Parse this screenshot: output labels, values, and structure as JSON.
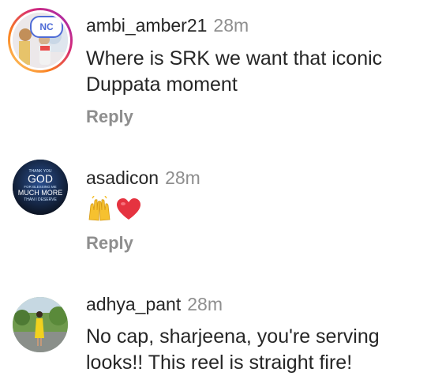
{
  "comments": [
    {
      "username": "ambi_amber21",
      "time": "28m",
      "text": "Where is SRK we want that iconic\nDuppata moment",
      "reply": "Reply",
      "avatar_badge": "NC"
    },
    {
      "username": "asadicon",
      "time": "28m",
      "emojis": [
        "raising-hands-icon",
        "red-heart-icon"
      ],
      "reply": "Reply",
      "avatar_text": {
        "small_top": "THANK YOU",
        "main": "GOD",
        "small_mid": "FOR BLESSING ME",
        "bottom1": "MUCH MORE",
        "bottom2": "THAN I DESERVE"
      }
    },
    {
      "username": "adhya_pant",
      "time": "28m",
      "text": "No cap, sharjeena, you're serving\nlooks!! This reel is straight fire!"
    }
  ],
  "colors": {
    "primary_text": "#262626",
    "secondary_text": "#8e8e8e",
    "background": "#ffffff",
    "story_ring_gradient": [
      "#feda75",
      "#fa7e1e",
      "#d62976",
      "#962fbf"
    ]
  }
}
